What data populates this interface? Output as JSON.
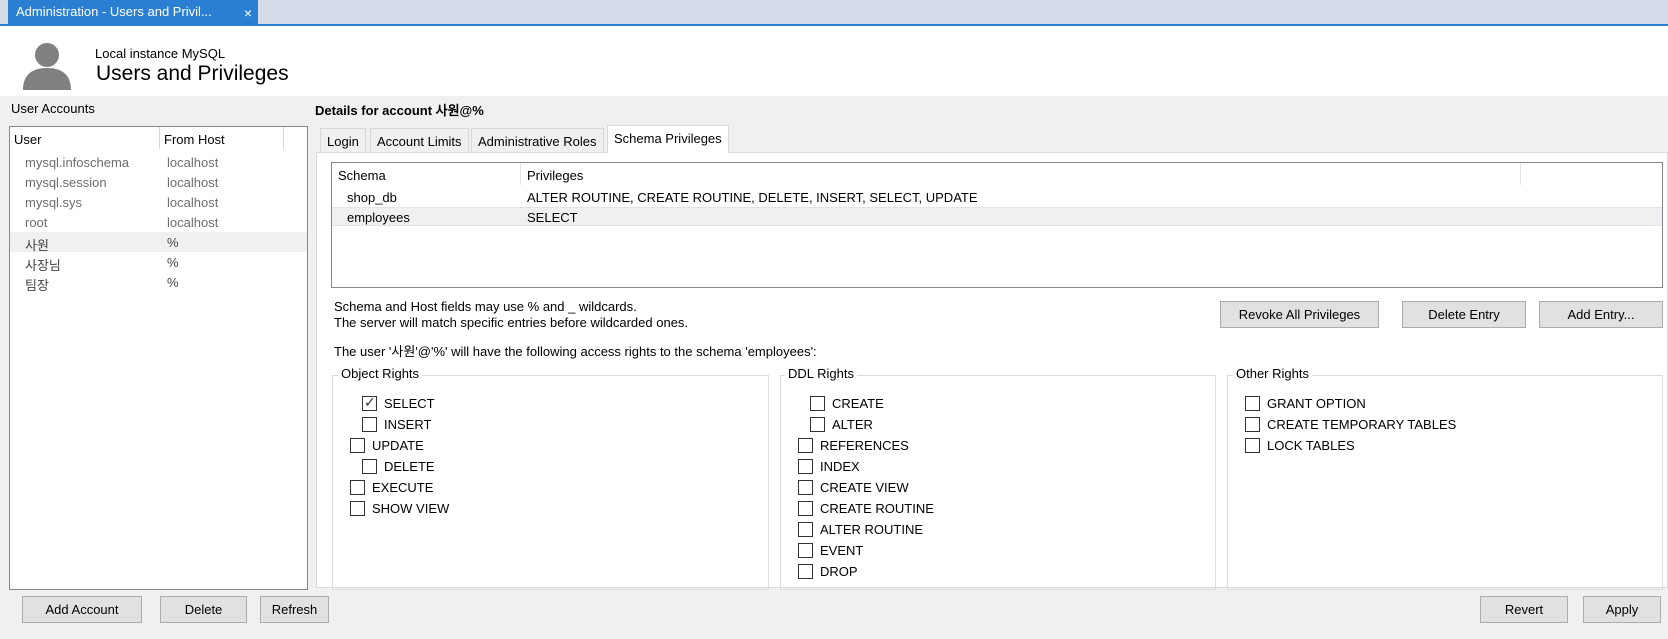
{
  "tab": {
    "title": "Administration - Users and Privil...",
    "close_glyph": "×"
  },
  "header": {
    "instance": "Local instance MySQL",
    "title": "Users and Privileges",
    "icon": "user-silhouette-icon"
  },
  "user_accounts": {
    "label": "User Accounts",
    "columns": [
      "User",
      "From Host"
    ],
    "rows": [
      {
        "user": "mysql.infoschema",
        "host": "localhost"
      },
      {
        "user": "mysql.session",
        "host": "localhost"
      },
      {
        "user": "mysql.sys",
        "host": "localhost"
      },
      {
        "user": "root",
        "host": "localhost"
      },
      {
        "user": "사원",
        "host": "%",
        "selected": true
      },
      {
        "user": "사장님",
        "host": "%"
      },
      {
        "user": "팀장",
        "host": "%"
      }
    ],
    "buttons": {
      "add": "Add Account",
      "delete": "Delete",
      "refresh": "Refresh"
    }
  },
  "details": {
    "title": "Details for account 사원@%",
    "tabs": [
      "Login",
      "Account Limits",
      "Administrative Roles",
      "Schema Privileges"
    ],
    "active_tab": "Schema Privileges",
    "schema_table": {
      "columns": [
        "Schema",
        "Privileges"
      ],
      "rows": [
        {
          "schema": "shop_db",
          "privileges": "ALTER ROUTINE, CREATE ROUTINE, DELETE, INSERT, SELECT, UPDATE"
        },
        {
          "schema": "employees",
          "privileges": "SELECT",
          "selected": true
        }
      ]
    },
    "hint_line1": "Schema and Host fields may use % and _ wildcards.",
    "hint_line2": "The server will match specific entries before wildcarded ones.",
    "access_note": "The user '사원'@'%' will have the following access rights to the schema 'employees':",
    "buttons": {
      "revoke_all": "Revoke All Privileges",
      "delete_entry": "Delete Entry",
      "add_entry": "Add Entry..."
    },
    "object_rights": {
      "title": "Object Rights",
      "items": [
        {
          "label": "SELECT",
          "checked": true
        },
        {
          "label": "INSERT",
          "checked": false
        },
        {
          "label": "UPDATE",
          "checked": false
        },
        {
          "label": "DELETE",
          "checked": false
        },
        {
          "label": "EXECUTE",
          "checked": false
        },
        {
          "label": "SHOW VIEW",
          "checked": false
        }
      ]
    },
    "ddl_rights": {
      "title": "DDL Rights",
      "items": [
        {
          "label": "CREATE",
          "checked": false
        },
        {
          "label": "ALTER",
          "checked": false
        },
        {
          "label": "REFERENCES",
          "checked": false
        },
        {
          "label": "INDEX",
          "checked": false
        },
        {
          "label": "CREATE VIEW",
          "checked": false
        },
        {
          "label": "CREATE ROUTINE",
          "checked": false
        },
        {
          "label": "ALTER ROUTINE",
          "checked": false
        },
        {
          "label": "EVENT",
          "checked": false
        },
        {
          "label": "DROP",
          "checked": false
        }
      ]
    },
    "other_rights": {
      "title": "Other Rights",
      "items": [
        {
          "label": "GRANT OPTION",
          "checked": false
        },
        {
          "label": "CREATE TEMPORARY TABLES",
          "checked": false
        },
        {
          "label": "LOCK TABLES",
          "checked": false
        }
      ]
    }
  },
  "footer": {
    "revert": "Revert",
    "apply": "Apply"
  }
}
